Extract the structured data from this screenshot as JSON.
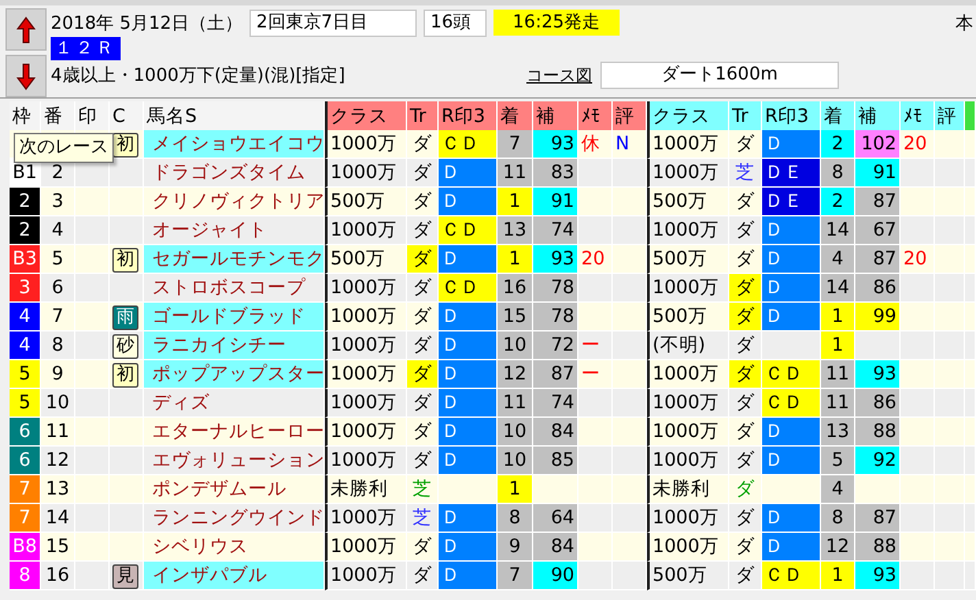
{
  "header": {
    "date": "2018年 5月12日（土）",
    "meeting": "2回東京7日目",
    "runners": "16頭",
    "post_time": "16:25発走",
    "cut_label": "本",
    "race_number": "１２Ｒ",
    "conditions": "4歳以上・1000万下(定量)(混)[指定]",
    "course_link": "コース図",
    "course": "ダート1600m"
  },
  "tooltip": "次のレース",
  "columns": [
    {
      "label": "枠",
      "kind": "horse"
    },
    {
      "label": "番",
      "kind": "horse"
    },
    {
      "label": "印",
      "kind": "horse"
    },
    {
      "label": "C",
      "kind": "horse"
    },
    {
      "label": "馬名S",
      "kind": "horse"
    },
    {
      "label": "クラス",
      "kind": "run_1"
    },
    {
      "label": "Tr",
      "kind": "run_1"
    },
    {
      "label": "R印3",
      "kind": "run_1"
    },
    {
      "label": "着",
      "kind": "run_1"
    },
    {
      "label": "補",
      "kind": "run_1"
    },
    {
      "label": "ﾒﾓ",
      "kind": "run_1"
    },
    {
      "label": "評",
      "kind": "run_1"
    },
    {
      "label": "クラス",
      "kind": "run_2"
    },
    {
      "label": "Tr",
      "kind": "run_2"
    },
    {
      "label": "R印3",
      "kind": "run_2"
    },
    {
      "label": "着",
      "kind": "run_2"
    },
    {
      "label": "補",
      "kind": "run_2"
    },
    {
      "label": "ﾒﾓ",
      "kind": "run_2"
    },
    {
      "label": "評",
      "kind": "run_2"
    },
    {
      "kind": "extra"
    }
  ],
  "rows": [
    {
      "badge": {
        "text": "初",
        "color": "#ffffc0"
      },
      "name": "メイショウエイコウ",
      "highlighted": true,
      "run_1": {
        "class": "1000万",
        "track": "ダ",
        "mark3": {
          "text": "ＣＤ",
          "color": "#ffff00"
        },
        "place": {
          "text": "7",
          "color": "#c0c0c0"
        },
        "rating": {
          "text": "93",
          "color": "#00ffff"
        },
        "memo": {
          "text": "休",
          "kind": "warning"
        },
        "eval": {
          "text": "N",
          "kind": "note"
        }
      },
      "run_2": {
        "class": "1000万",
        "track": "ダ",
        "mark3": {
          "text": "Ｄ",
          "color": "#0080ff"
        },
        "place": {
          "text": "2",
          "color": "#00ffff"
        },
        "rating": {
          "text": "102",
          "color": "#ff80ff"
        },
        "memo": {
          "text": "20",
          "kind": "warning"
        }
      }
    },
    {
      "waku": {
        "text": "B1",
        "color": "#ffffff"
      },
      "number": "2",
      "name": "ドラゴンズタイム",
      "highlighted": false,
      "run_1": {
        "class": "1000万",
        "track": "ダ",
        "mark3": {
          "text": "Ｄ",
          "color": "#0080ff"
        },
        "place": {
          "text": "11",
          "color": "#c0c0c0"
        },
        "rating": {
          "text": "83",
          "color": "#c0c0c0"
        }
      },
      "run_2": {
        "class": "1000万",
        "track": {
          "text": "芝",
          "kind": "turf"
        },
        "mark3": {
          "text": "ＤＥ",
          "color": "#0000e0"
        },
        "place": {
          "text": "8",
          "color": "#c0c0c0"
        },
        "rating": {
          "text": "91",
          "color": "#00ffff"
        }
      }
    },
    {
      "waku": {
        "text": "2",
        "color": "#000000"
      },
      "number": "3",
      "name": "クリノヴィクトリア",
      "highlighted": false,
      "run_1": {
        "class": "500万",
        "track": "ダ",
        "mark3": {
          "text": "Ｄ",
          "color": "#0080ff"
        },
        "place": {
          "text": "1",
          "color": "#ffff00"
        },
        "rating": {
          "text": "91",
          "color": "#00ffff"
        }
      },
      "run_2": {
        "class": "500万",
        "track": "ダ",
        "mark3": {
          "text": "ＤＥ",
          "color": "#0000e0"
        },
        "place": {
          "text": "2",
          "color": "#00ffff"
        },
        "rating": {
          "text": "87",
          "color": "#c0c0c0"
        }
      }
    },
    {
      "waku": {
        "text": "2",
        "color": "#000000"
      },
      "number": "4",
      "name": "オージャイト",
      "highlighted": false,
      "run_1": {
        "class": "1000万",
        "track": "ダ",
        "mark3": {
          "text": "ＣＤ",
          "color": "#ffff00"
        },
        "place": {
          "text": "13",
          "color": "#c0c0c0"
        },
        "rating": {
          "text": "74",
          "color": "#c0c0c0"
        }
      },
      "run_2": {
        "class": "1000万",
        "track": "ダ",
        "mark3": {
          "text": "Ｄ",
          "color": "#0080ff"
        },
        "place": {
          "text": "14",
          "color": "#c0c0c0"
        },
        "rating": {
          "text": "67",
          "color": "#c0c0c0"
        }
      }
    },
    {
      "waku": {
        "text": "B3",
        "color": "#ff2020"
      },
      "number": "5",
      "badge": {
        "text": "初",
        "color": "#ffffc0"
      },
      "name": "セガールモチンモク",
      "highlighted": true,
      "run_1": {
        "class": "500万",
        "track": {
          "text": "ダ",
          "color": "#ffff00"
        },
        "mark3": {
          "text": "Ｄ",
          "color": "#0080ff"
        },
        "place": {
          "text": "1",
          "color": "#ffff00"
        },
        "rating": {
          "text": "93",
          "color": "#00ffff"
        },
        "memo": {
          "text": "20",
          "kind": "warning"
        }
      },
      "run_2": {
        "class": "500万",
        "track": "ダ",
        "mark3": {
          "text": "Ｄ",
          "color": "#0080ff"
        },
        "place": {
          "text": "4",
          "color": "#c0c0c0"
        },
        "rating": {
          "text": "87",
          "color": "#c0c0c0"
        },
        "memo": {
          "text": "20",
          "kind": "warning"
        }
      }
    },
    {
      "waku": {
        "text": "3",
        "color": "#ff2020"
      },
      "number": "6",
      "name": "ストロボスコープ",
      "highlighted": false,
      "run_1": {
        "class": "1000万",
        "track": "ダ",
        "mark3": {
          "text": "ＣＤ",
          "color": "#ffff00"
        },
        "place": {
          "text": "16",
          "color": "#c0c0c0"
        },
        "rating": {
          "text": "78",
          "color": "#c0c0c0"
        }
      },
      "run_2": {
        "class": "1000万",
        "track": {
          "text": "ダ",
          "color": "#ffff00"
        },
        "mark3": {
          "text": "Ｄ",
          "color": "#0080ff"
        },
        "place": {
          "text": "14",
          "color": "#c0c0c0"
        },
        "rating": {
          "text": "86",
          "color": "#c0c0c0"
        }
      }
    },
    {
      "waku": {
        "text": "4",
        "color": "#0000ff"
      },
      "number": "7",
      "badge": {
        "text": "雨",
        "color": "#008080"
      },
      "name": "ゴールドブラッド",
      "highlighted": true,
      "run_1": {
        "class": "1000万",
        "track": "ダ",
        "mark3": {
          "text": "Ｄ",
          "color": "#0080ff"
        },
        "place": {
          "text": "15",
          "color": "#c0c0c0"
        },
        "rating": {
          "text": "78",
          "color": "#c0c0c0"
        }
      },
      "run_2": {
        "class": "500万",
        "track": {
          "text": "ダ",
          "color": "#ffff00"
        },
        "mark3": {
          "text": "Ｄ",
          "color": "#0080ff"
        },
        "place": {
          "text": "1",
          "color": "#ffff00"
        },
        "rating": {
          "text": "99",
          "color": "#ffff00"
        }
      }
    },
    {
      "waku": {
        "text": "4",
        "color": "#0000ff"
      },
      "number": "8",
      "badge": {
        "text": "砂",
        "color": "#ffffe0"
      },
      "name": "ラニカイシチー",
      "highlighted": true,
      "run_1": {
        "class": "1000万",
        "track": "ダ",
        "mark3": {
          "text": "Ｄ",
          "color": "#0080ff"
        },
        "place": {
          "text": "10",
          "color": "#c0c0c0"
        },
        "rating": {
          "text": "72",
          "color": "#c0c0c0"
        },
        "memo": {
          "text": "ー",
          "kind": "warning"
        }
      },
      "run_2": {
        "class": "(不明)",
        "track": "ダ",
        "place": {
          "text": "1",
          "color": "#ffff00"
        }
      }
    },
    {
      "waku": {
        "text": "5",
        "color": "#ffff00"
      },
      "number": "9",
      "badge": {
        "text": "初",
        "color": "#ffffc0"
      },
      "name": "ポップアップスター",
      "highlighted": true,
      "run_1": {
        "class": "1000万",
        "track": {
          "text": "ダ",
          "color": "#ffff00"
        },
        "mark3": {
          "text": "Ｄ",
          "color": "#0080ff"
        },
        "place": {
          "text": "12",
          "color": "#c0c0c0"
        },
        "rating": {
          "text": "87",
          "color": "#c0c0c0"
        },
        "memo": {
          "text": "ー",
          "kind": "warning"
        }
      },
      "run_2": {
        "class": "1000万",
        "track": {
          "text": "ダ",
          "color": "#ffff00"
        },
        "mark3": {
          "text": "ＣＤ",
          "color": "#ffff00"
        },
        "place": {
          "text": "11",
          "color": "#c0c0c0"
        },
        "rating": {
          "text": "93",
          "color": "#00ffff"
        }
      }
    },
    {
      "waku": {
        "text": "5",
        "color": "#ffff00"
      },
      "number": "10",
      "name": "ディズ",
      "highlighted": false,
      "run_1": {
        "class": "1000万",
        "track": "ダ",
        "mark3": {
          "text": "Ｄ",
          "color": "#0080ff"
        },
        "place": {
          "text": "11",
          "color": "#c0c0c0"
        },
        "rating": {
          "text": "74",
          "color": "#c0c0c0"
        }
      },
      "run_2": {
        "class": "1000万",
        "track": "ダ",
        "mark3": {
          "text": "ＣＤ",
          "color": "#ffff00"
        },
        "place": {
          "text": "11",
          "color": "#c0c0c0"
        },
        "rating": {
          "text": "86",
          "color": "#c0c0c0"
        }
      }
    },
    {
      "waku": {
        "text": "6",
        "color": "#008080"
      },
      "number": "11",
      "name": "エターナルヒーロー",
      "highlighted": false,
      "run_1": {
        "class": "1000万",
        "track": "ダ",
        "mark3": {
          "text": "Ｄ",
          "color": "#0080ff"
        },
        "place": {
          "text": "10",
          "color": "#c0c0c0"
        },
        "rating": {
          "text": "84",
          "color": "#c0c0c0"
        }
      },
      "run_2": {
        "class": "1000万",
        "track": "ダ",
        "mark3": {
          "text": "Ｄ",
          "color": "#0080ff"
        },
        "place": {
          "text": "13",
          "color": "#c0c0c0"
        },
        "rating": {
          "text": "88",
          "color": "#c0c0c0"
        }
      }
    },
    {
      "waku": {
        "text": "6",
        "color": "#008080"
      },
      "number": "12",
      "name": "エヴォリューション",
      "highlighted": false,
      "run_1": {
        "class": "1000万",
        "track": "ダ",
        "mark3": {
          "text": "Ｄ",
          "color": "#0080ff"
        },
        "place": {
          "text": "10",
          "color": "#c0c0c0"
        },
        "rating": {
          "text": "85",
          "color": "#c0c0c0"
        }
      },
      "run_2": {
        "class": "1000万",
        "track": "ダ",
        "mark3": {
          "text": "Ｄ",
          "color": "#0080ff"
        },
        "place": {
          "text": "5",
          "color": "#c0c0c0"
        },
        "rating": {
          "text": "92",
          "color": "#00ffff"
        }
      }
    },
    {
      "waku": {
        "text": "7",
        "color": "#ff8000"
      },
      "number": "13",
      "name": "ポンデザムール",
      "highlighted": false,
      "run_1": {
        "class": "未勝利",
        "track": {
          "text": "芝",
          "kind": "local"
        },
        "place": {
          "text": "1",
          "color": "#ffff00"
        }
      },
      "run_2": {
        "class": "未勝利",
        "track": {
          "text": "ダ",
          "kind": "local"
        },
        "place": {
          "text": "4",
          "color": "#c0c0c0"
        }
      }
    },
    {
      "waku": {
        "text": "7",
        "color": "#ff8000"
      },
      "number": "14",
      "name": "ランニングウインド",
      "highlighted": false,
      "run_1": {
        "class": "1000万",
        "track": {
          "text": "芝",
          "kind": "turf"
        },
        "mark3": {
          "text": "Ｄ",
          "color": "#0080ff"
        },
        "place": {
          "text": "8",
          "color": "#c0c0c0"
        },
        "rating": {
          "text": "64",
          "color": "#c0c0c0"
        }
      },
      "run_2": {
        "class": "1000万",
        "track": "ダ",
        "mark3": {
          "text": "Ｄ",
          "color": "#0080ff"
        },
        "place": {
          "text": "8",
          "color": "#c0c0c0"
        },
        "rating": {
          "text": "87",
          "color": "#c0c0c0"
        }
      }
    },
    {
      "waku": {
        "text": "B8",
        "color": "#ff00ff"
      },
      "number": "15",
      "name": "シベリウス",
      "highlighted": false,
      "run_1": {
        "class": "1000万",
        "track": "ダ",
        "mark3": {
          "text": "Ｄ",
          "color": "#0080ff"
        },
        "place": {
          "text": "9",
          "color": "#c0c0c0"
        },
        "rating": {
          "text": "84",
          "color": "#c0c0c0"
        }
      },
      "run_2": {
        "class": "1000万",
        "track": "ダ",
        "mark3": {
          "text": "Ｄ",
          "color": "#0080ff"
        },
        "place": {
          "text": "12",
          "color": "#c0c0c0"
        },
        "rating": {
          "text": "88",
          "color": "#c0c0c0"
        }
      }
    },
    {
      "waku": {
        "text": "8",
        "color": "#ff00ff"
      },
      "number": "16",
      "badge": {
        "text": "見",
        "color": "#c8b4b4"
      },
      "name": "インザパブル",
      "highlighted": true,
      "run_1": {
        "class": "1000万",
        "track": "ダ",
        "mark3": {
          "text": "Ｄ",
          "color": "#0080ff"
        },
        "place": {
          "text": "7",
          "color": "#c0c0c0"
        },
        "rating": {
          "text": "90",
          "color": "#00ffff"
        }
      },
      "run_2": {
        "class": "500万",
        "track": "ダ",
        "mark3": {
          "text": "ＣＤ",
          "color": "#ffff00"
        },
        "place": {
          "text": "1",
          "color": "#ffff00"
        },
        "rating": {
          "text": "93",
          "color": "#00ffff"
        }
      }
    }
  ]
}
